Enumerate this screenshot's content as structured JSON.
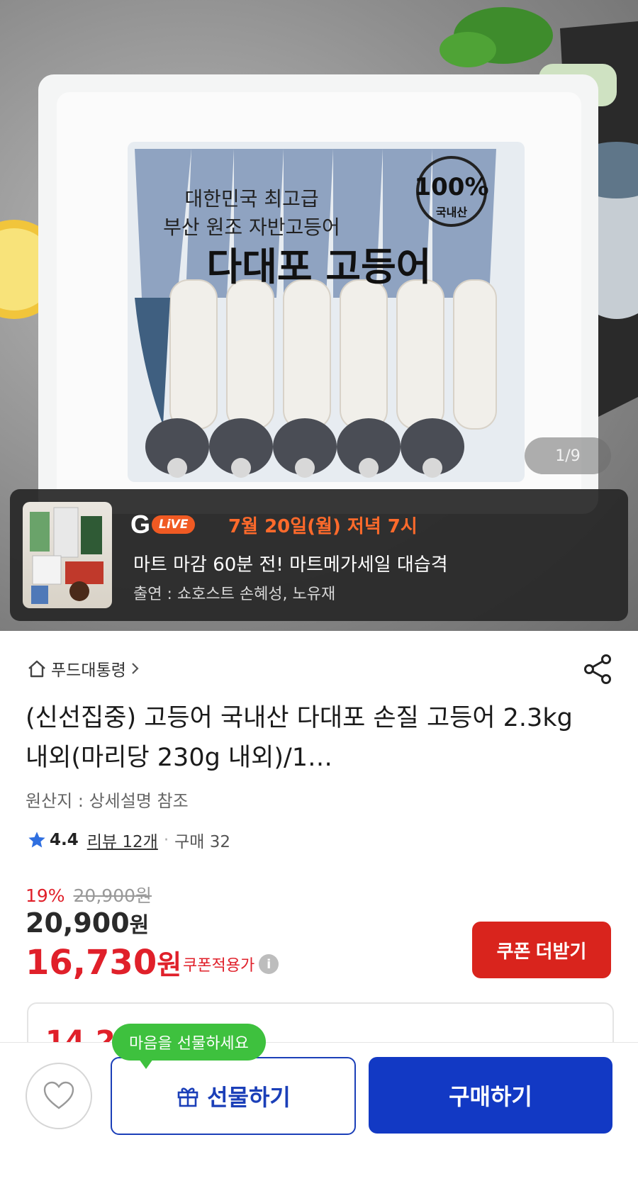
{
  "gallery": {
    "counter": "1/9"
  },
  "package_text": {
    "line1": "대한민국 최고급",
    "line2": "부산 원조 자반고등어",
    "name": "다대포 고등어",
    "badge_top": "100%",
    "badge_bottom": "국내산"
  },
  "live": {
    "logo_g": "G",
    "logo_live": "LiVE",
    "date": "7월 20일(월) 저녁 7시",
    "title": "마트 마감 60분 전! 마트메가세일 대습격",
    "cast": "출연 : 쇼호스트 손혜성, 노유재"
  },
  "store": {
    "name": "푸드대통령"
  },
  "product": {
    "title": "(신선집중) 고등어 국내산 다대포 손질 고등어 2.3kg내외(마리당 230g 내외)/1…",
    "origin": "원산지 : 상세설명 참조"
  },
  "rating": {
    "score": "4.4",
    "reviews": "리뷰 12개",
    "sep": "·",
    "purchases": "구매 32"
  },
  "pricing": {
    "discount_rate": "19%",
    "original_price": "20,900원",
    "price_number": "20,900",
    "price_unit": "원",
    "coupon_number": "16,730",
    "coupon_unit": "원",
    "coupon_label": "쿠폰적용가",
    "coupon_button": "쿠폰 더받기",
    "partial_amount": "14,2"
  },
  "bottom": {
    "gift_tip": "마음을 선물하세요",
    "gift_label": "선물하기",
    "buy_label": "구매하기"
  },
  "colors": {
    "accent_red": "#e0202a",
    "primary_blue": "#1239c4",
    "live_orange": "#ff6a2b",
    "tip_green": "#3ec13e"
  }
}
